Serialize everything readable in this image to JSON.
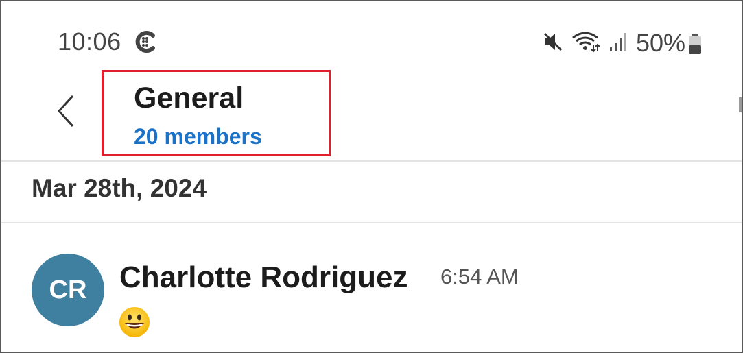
{
  "status_bar": {
    "time": "10:06",
    "battery_percent": "50%",
    "icons": [
      "app-notification-icon",
      "mute-icon",
      "wifi-icon",
      "signal-icon",
      "battery-icon"
    ]
  },
  "header": {
    "title": "General",
    "members": "20 members",
    "back_icon": "chevron-left-icon"
  },
  "date_divider": "Mar 28th, 2024",
  "message": {
    "avatar_initials": "CR",
    "sender": "Charlotte Rodriguez",
    "time": "6:54 AM",
    "content_emoji": "grinning-face-icon"
  },
  "colors": {
    "accent_link": "#1a73c8",
    "highlight_box": "#e0202d",
    "avatar_bg": "#3f7f9f"
  }
}
